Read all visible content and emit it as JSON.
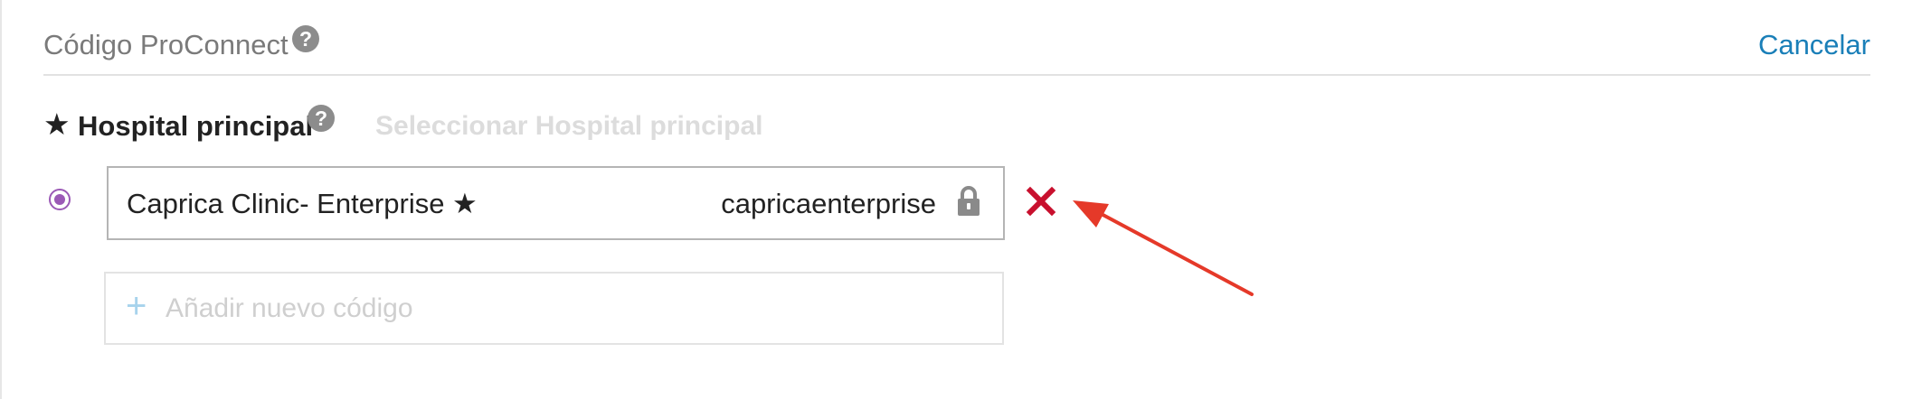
{
  "header": {
    "title": "Código ProConnect",
    "help_glyph": "?",
    "cancel_label": "Cancelar"
  },
  "primary_hospital": {
    "star": "★",
    "label": "Hospital principal",
    "help_glyph": "?",
    "select_link": "Seleccionar Hospital principal"
  },
  "codes": [
    {
      "hospital": "Caprica Clinic- Enterprise ★",
      "code": "capricaenterprise",
      "selected": true,
      "locked": true
    }
  ],
  "add_code": {
    "plus": "+",
    "label": "Añadir nuevo código"
  },
  "colors": {
    "accent_link": "#1a7fb8",
    "radio": "#9b59b6",
    "remove": "#c8102e",
    "annotation_arrow": "#e53929"
  },
  "icons": [
    "help-icon",
    "star-icon",
    "radio-selected-icon",
    "lock-icon",
    "remove-icon",
    "plus-icon",
    "annotation-arrow"
  ]
}
